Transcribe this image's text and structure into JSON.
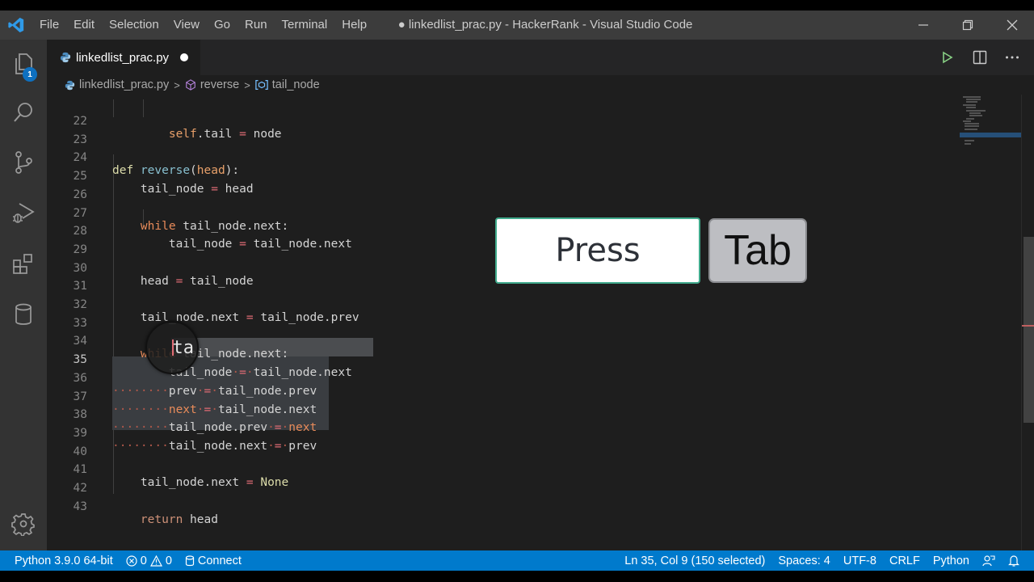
{
  "window": {
    "title": "● linkedlist_prac.py - HackerRank - Visual Studio Code",
    "controls": [
      "minimize",
      "restore",
      "close"
    ]
  },
  "menu": [
    "File",
    "Edit",
    "Selection",
    "View",
    "Go",
    "Run",
    "Terminal",
    "Help"
  ],
  "activity_bar": {
    "items": [
      {
        "name": "explorer",
        "icon": "files-icon",
        "badge": "1"
      },
      {
        "name": "search",
        "icon": "search-icon"
      },
      {
        "name": "source-control",
        "icon": "source-control-icon"
      },
      {
        "name": "run-debug",
        "icon": "run-debug-icon"
      },
      {
        "name": "extensions",
        "icon": "extensions-icon"
      },
      {
        "name": "database",
        "icon": "database-icon"
      }
    ],
    "bottom": [
      {
        "name": "manage",
        "icon": "gear-icon"
      }
    ]
  },
  "tab": {
    "label": "linkedlist_prac.py",
    "dirty": true
  },
  "breadcrumb": [
    {
      "label": "linkedlist_prac.py",
      "icon": "python-icon"
    },
    {
      "label": "reverse",
      "icon": "method-icon"
    },
    {
      "label": "tail_node",
      "icon": "variable-icon"
    }
  ],
  "code": {
    "lines": [
      {
        "n": "22",
        "text": "            self.tail = node"
      },
      {
        "n": "23",
        "text": ""
      },
      {
        "n": "24",
        "text": "def reverse(head):"
      },
      {
        "n": "25",
        "text": "    tail_node = head"
      },
      {
        "n": "26",
        "text": ""
      },
      {
        "n": "27",
        "text": "    while tail_node.next:"
      },
      {
        "n": "28",
        "text": "        tail_node = tail_node.next"
      },
      {
        "n": "29",
        "text": ""
      },
      {
        "n": "30",
        "text": "    head = tail_node"
      },
      {
        "n": "31",
        "text": ""
      },
      {
        "n": "32",
        "text": "    tail_node.next = tail_node.prev"
      },
      {
        "n": "33",
        "text": ""
      },
      {
        "n": "34",
        "text": "    while tail_node.next:"
      },
      {
        "n": "35",
        "text": "        tail_node = tail_node.next"
      },
      {
        "n": "36",
        "text": "        prev = tail_node.prev"
      },
      {
        "n": "37",
        "text": "        next = tail_node.next"
      },
      {
        "n": "38",
        "text": "        tail_node.prev = next"
      },
      {
        "n": "39",
        "text": "        tail_node.next = prev"
      },
      {
        "n": "40",
        "text": ""
      },
      {
        "n": "41",
        "text": "    tail_node.next = None"
      },
      {
        "n": "42",
        "text": ""
      },
      {
        "n": "43",
        "text": "    return head"
      }
    ],
    "active_line": "35",
    "magnifier_text": "ta"
  },
  "key_overlay": {
    "press_label": "Press",
    "key_label": "Tab"
  },
  "statusbar": {
    "python": "Python 3.9.0 64-bit",
    "errors": "0",
    "warnings": "0",
    "connect": "Connect",
    "position": "Ln 35, Col 9 (150 selected)",
    "spaces": "Spaces: 4",
    "encoding": "UTF-8",
    "eol": "CRLF",
    "language": "Python"
  },
  "colors": {
    "statusbar": "#007acc",
    "titlebar": "#3c3c3c",
    "editor_bg": "#1e1e1e",
    "badge": "#0e70c0",
    "run_icon": "#89d185",
    "key_border": "#3fa98b"
  }
}
